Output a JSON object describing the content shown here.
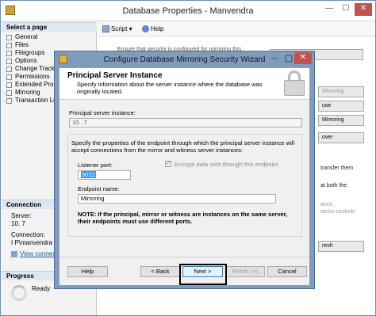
{
  "outer": {
    "title": "Database Properties - Manvendra",
    "min": "—",
    "max": "☐",
    "close": "✕"
  },
  "left": {
    "select_page": "Select a page",
    "pages": [
      "General",
      "Files",
      "Filegroups",
      "Options",
      "Change Track",
      "Permissions",
      "Extended Prop",
      "Mirroring",
      "Transaction Lo"
    ],
    "connection": "Connection",
    "server_label": "Server:",
    "server_value": "10.           7",
    "connection_label": "Connection:",
    "connection_value": "I     P\\manvendra",
    "view_link": "View connec",
    "progress": "Progress",
    "ready": "Ready"
  },
  "toolbar": {
    "script": "Script",
    "help": "Help"
  },
  "bg": {
    "ensure": "Ensure that security is configured for mirroring this",
    "config_btn": "...curity...",
    "b1": "Mirroring",
    "b2": "use",
    "b3": "Mirroring",
    "b4": "over",
    "t1": "transfer them",
    "t2": "at both the",
    "t3": "ance,",
    "t4": "tance controls",
    "b5": "resh"
  },
  "wizard": {
    "title": "Configure Database Mirroring Security Wizard",
    "min": "—",
    "close": "✕",
    "heading": "Principal Server Instance",
    "subheading": "Specify information about the server instance where the database was originally located.",
    "principal_label": "Principal server instance:",
    "principal_value": "10.            .7",
    "specify_text": "Specify the properties of the endpoint through which the principal server instance will accept connections from the mirror and witness server instances:",
    "listener_label": "Listener port:",
    "listener_value": "5022",
    "encrypt_label": "Encrypt data sent through this endpoint",
    "endpoint_label": "Endpoint name:",
    "endpoint_value": "Mirroring",
    "note": "NOTE: If the principal, mirror or witness are instances on the same server, their endpoints must use different ports.",
    "buttons": {
      "help": "Help",
      "back": "< Back",
      "next": "Next >",
      "finish": "Finish >>|",
      "cancel": "Cancel"
    }
  }
}
